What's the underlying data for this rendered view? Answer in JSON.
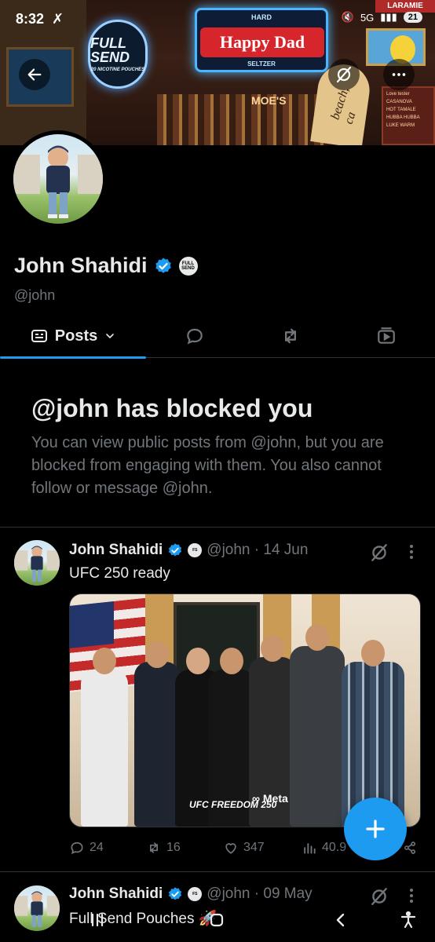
{
  "status_bar": {
    "time": "8:32",
    "network": "5G",
    "battery": "21"
  },
  "banner": {
    "sign_full_send": "FULL SEND",
    "sign_full_send_sub": "20 NICOTINE POUCHES",
    "sign_hard": "HARD",
    "sign_happy_dad": "Happy Dad",
    "sign_seltzer": "SELTZER",
    "sign_moes": "MOE'S",
    "sign_laramie": "LARAMIE",
    "surfboard_text": "beach, ca",
    "menu_title": "Love tester",
    "menu_items": [
      "CASANOVA",
      "HOT TAMALE",
      "HUBBA HUBBA",
      "LUKE WARM"
    ]
  },
  "profile": {
    "display_name": "John Shahidi",
    "handle": "@john",
    "affiliate_badge": "FULL SEND"
  },
  "tabs": {
    "posts_label": "Posts"
  },
  "blocked": {
    "title": "@john has blocked you",
    "message": "You can view public posts from @john, but you are blocked from engaging with them. You also cannot follow or message @john."
  },
  "posts": [
    {
      "name": "John Shahidi",
      "meta": "@john · 14 Jun",
      "text": "UFC 250 ready",
      "photo_brand1": "UFC FREEDOM 250",
      "photo_brand2": "∞ Meta",
      "replies": "24",
      "reposts": "16",
      "likes": "347",
      "views": "40.9"
    },
    {
      "name": "John Shahidi",
      "meta": "@john · 09 May",
      "text": "Full Send Pouches 🚀"
    }
  ],
  "icons": {
    "back": "arrow-left-icon",
    "grok": "grok-icon",
    "more": "more-horizontal-icon",
    "compose": "plus-icon"
  },
  "colors": {
    "accent": "#1d9bf0",
    "background": "#000000",
    "secondary_text": "#71767b"
  }
}
